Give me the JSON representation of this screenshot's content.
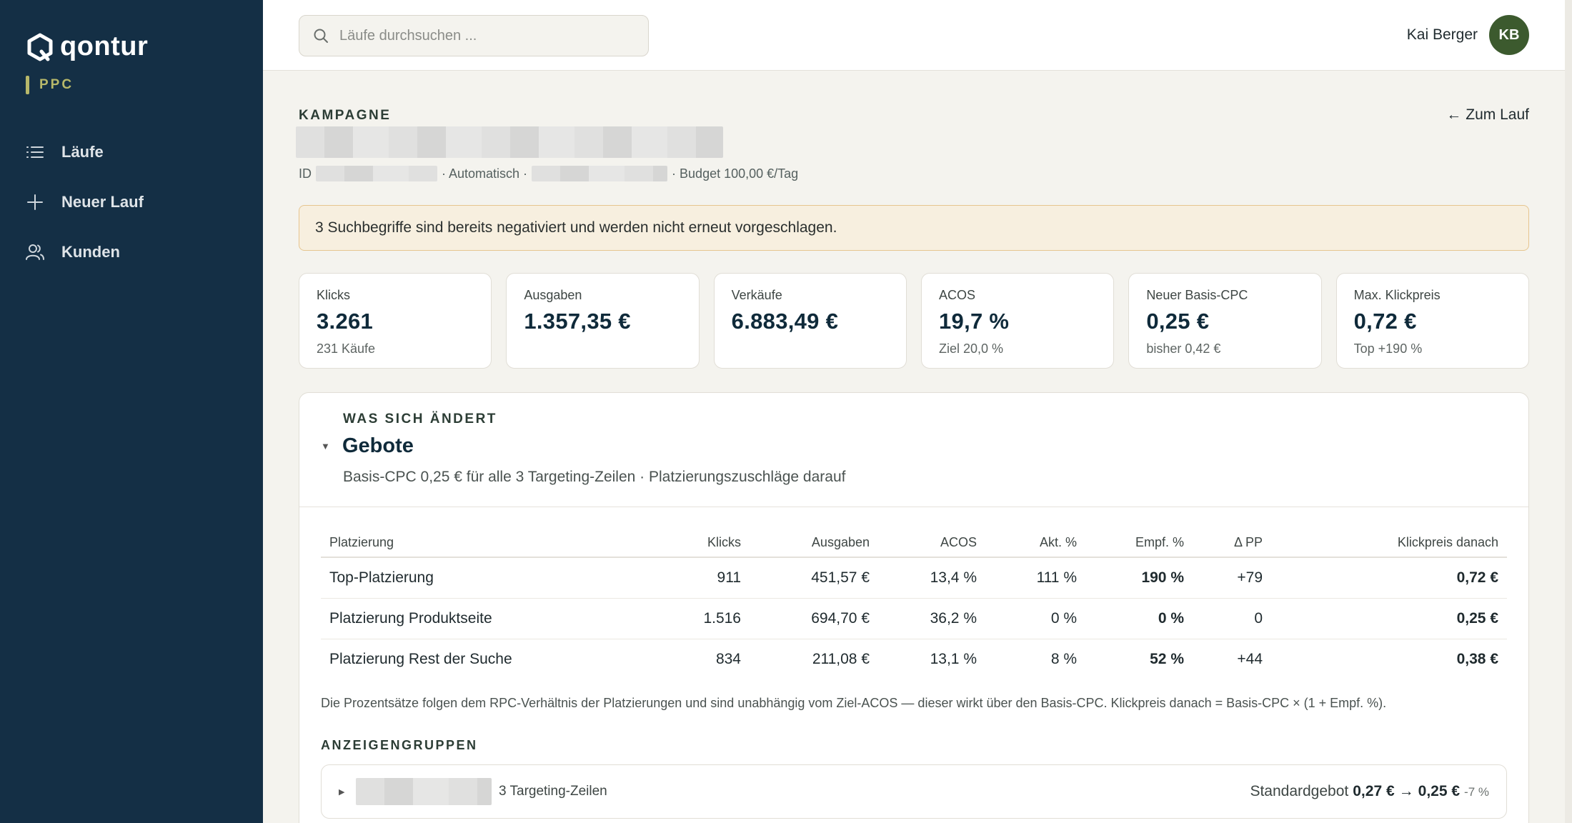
{
  "sidebar": {
    "brand": "qontur",
    "product": "PPC",
    "nav": [
      {
        "label": "Läufe",
        "icon": "list-icon"
      },
      {
        "label": "Neuer Lauf",
        "icon": "plus-icon"
      },
      {
        "label": "Kunden",
        "icon": "users-icon"
      }
    ]
  },
  "topbar": {
    "search_placeholder": "Läufe durchsuchen ...",
    "user_name": "Kai Berger",
    "user_initials": "KB"
  },
  "campaign": {
    "overline": "KAMPAGNE",
    "back_link": "Zum Lauf",
    "meta_id_label": "ID",
    "meta_type": "· Automatisch ·",
    "meta_budget": "· Budget 100,00 €/Tag"
  },
  "notice": "3 Suchbegriffe sind bereits negativiert und werden nicht erneut vorgeschlagen.",
  "kpis": [
    {
      "label": "Klicks",
      "value": "3.261",
      "sub": "231 Käufe"
    },
    {
      "label": "Ausgaben",
      "value": "1.357,35 €",
      "sub": ""
    },
    {
      "label": "Verkäufe",
      "value": "6.883,49 €",
      "sub": ""
    },
    {
      "label": "ACOS",
      "value": "19,7 %",
      "sub": "Ziel 20,0 %"
    },
    {
      "label": "Neuer Basis-CPC",
      "value": "0,25 €",
      "sub": "bisher 0,42 €"
    },
    {
      "label": "Max. Klickpreis",
      "value": "0,72 €",
      "sub": "Top +190 %"
    }
  ],
  "changes": {
    "overline": "WAS SICH ÄNDERT",
    "title": "Gebote",
    "subtitle": "Basis-CPC 0,25 € für alle 3 Targeting-Zeilen · Platzierungszuschläge darauf",
    "columns": [
      "Platzierung",
      "Klicks",
      "Ausgaben",
      "ACOS",
      "Akt. %",
      "Empf. %",
      "Δ PP",
      "Klickpreis danach"
    ],
    "rows": [
      {
        "placement": "Top-Platzierung",
        "clicks": "911",
        "spend": "451,57 €",
        "acos": "13,4 %",
        "acos_status": "good",
        "current": "111 %",
        "recommended": "190 %",
        "delta": "+79",
        "price_after": "0,72 €"
      },
      {
        "placement": "Platzierung Produktseite",
        "clicks": "1.516",
        "spend": "694,70 €",
        "acos": "36,2 %",
        "acos_status": "bad",
        "current": "0 %",
        "recommended": "0 %",
        "delta": "0",
        "price_after": "0,25 €"
      },
      {
        "placement": "Platzierung Rest der Suche",
        "clicks": "834",
        "spend": "211,08 €",
        "acos": "13,1 %",
        "acos_status": "good",
        "current": "8 %",
        "recommended": "52 %",
        "delta": "+44",
        "price_after": "0,38 €"
      }
    ],
    "footnote": "Die Prozentsätze folgen dem RPC-Verhältnis der Platzierungen und sind unabhängig vom Ziel-ACOS — dieser wirkt über den Basis-CPC. Klickpreis danach = Basis-CPC × (1 + Empf. %).",
    "adgroups_label": "ANZEIGENGRUPPEN",
    "adgroup": {
      "count": "3 Targeting-Zeilen",
      "default_bid_label": "Standardgebot",
      "old_bid": "0,27 €",
      "arrow": "→",
      "new_bid": "0,25 €",
      "delta": "-7 %"
    }
  },
  "colors": {
    "sidebar": "#142f45",
    "accent_green": "#3c5a2e",
    "good": "#4f6a2a",
    "bad": "#8b3a2d",
    "notice_bg": "#f7efdf"
  }
}
